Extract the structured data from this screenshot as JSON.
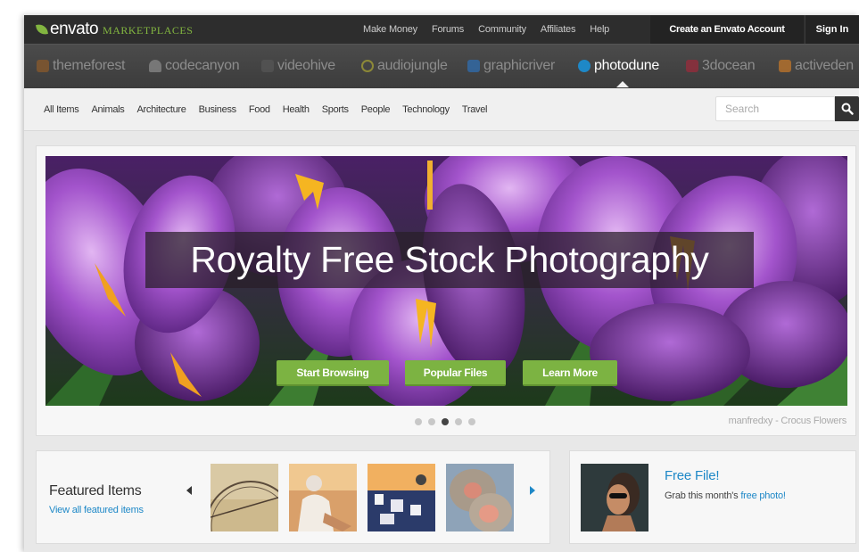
{
  "header": {
    "brand": "envato",
    "brand_sub": "MARKETPLACES",
    "nav": [
      "Make Money",
      "Forums",
      "Community",
      "Affiliates",
      "Help"
    ],
    "create_account": "Create an Envato Account",
    "sign_in": "Sign In"
  },
  "marketplaces": {
    "items": [
      "themeforest",
      "codecanyon",
      "videohive",
      "audiojungle",
      "graphicriver",
      "photodune",
      "3docean",
      "activeden"
    ],
    "active": "photodune"
  },
  "categories": {
    "items": [
      "All Items",
      "Animals",
      "Architecture",
      "Business",
      "Food",
      "Health",
      "Sports",
      "People",
      "Technology",
      "Travel"
    ]
  },
  "search": {
    "placeholder": "Search"
  },
  "hero": {
    "title": "Royalty Free Stock Photography",
    "buttons": [
      "Start Browsing",
      "Popular Files",
      "Learn More"
    ],
    "credit": "manfredxy - Crocus Flowers",
    "active_slide": 3,
    "slide_count": 5
  },
  "featured": {
    "title": "Featured Items",
    "link": "View all featured items"
  },
  "free_file": {
    "title": "Free File!",
    "desc_prefix": "Grab this month's ",
    "desc_link": "free photo!"
  },
  "colors": {
    "accent_green": "#7cb342",
    "link_blue": "#1e88c7",
    "topbar": "#2d2d2d"
  }
}
